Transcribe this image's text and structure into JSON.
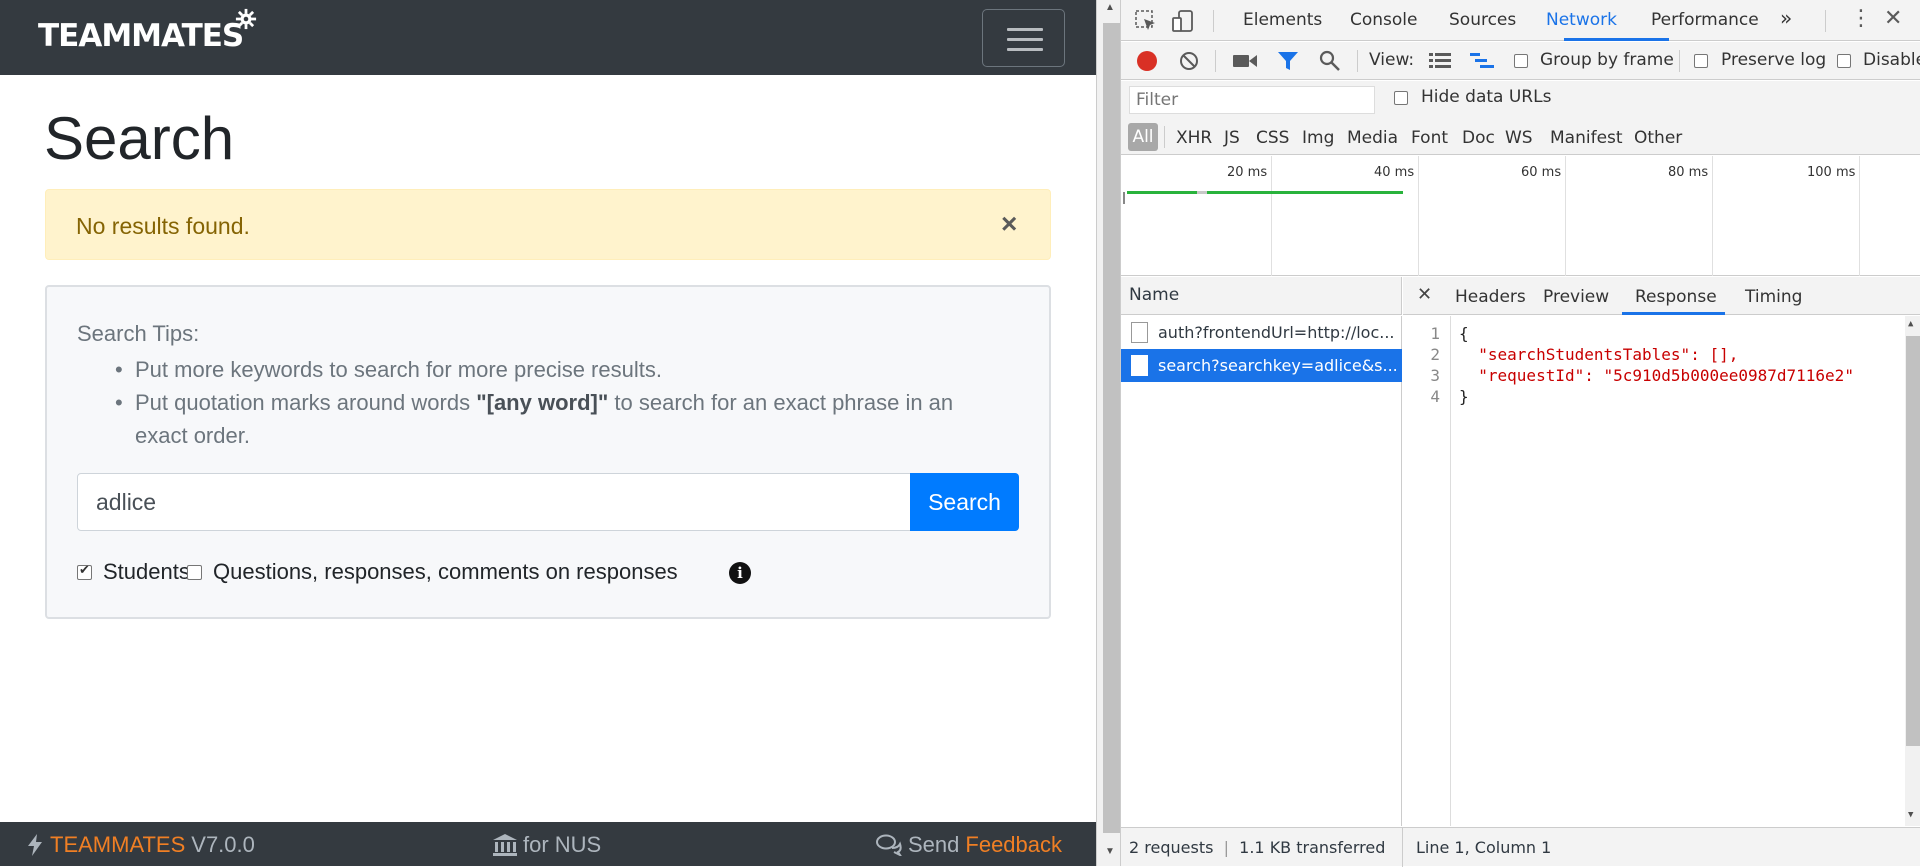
{
  "app": {
    "logo_text": "TEAMMATES",
    "page_title": "Search",
    "alert": {
      "text": "No results found.",
      "close": "×"
    },
    "tips": {
      "title": "Search Tips:",
      "item1": "Put more keywords to search for more precise results.",
      "item2_before": "Put quotation marks around words ",
      "item2_bold": "\"[any word]\"",
      "item2_after": " to search for an exact phrase in an exact order."
    },
    "search": {
      "value": "adlice",
      "button_label": "Search"
    },
    "options": {
      "students_label": "Students",
      "students_checked": true,
      "questions_label": "Questions, responses, comments on responses",
      "questions_checked": false
    },
    "footer": {
      "brand": "TEAMMATES",
      "version": "V7.0.0",
      "institution": "for NUS",
      "send": "Send",
      "feedback": "Feedback"
    },
    "colors": {
      "navbar": "#343a40",
      "accent": "#007bff",
      "footer_orange": "#f07f24",
      "alert_bg": "#fff3cd"
    }
  },
  "devtools": {
    "tabs": [
      "Elements",
      "Console",
      "Sources",
      "Network",
      "Performance"
    ],
    "active_tab": "Network",
    "more_tabs": "»",
    "toolbar": {
      "view_label": "View:",
      "group_by_frame": "Group by frame",
      "preserve_log": "Preserve log",
      "disable_cache": "Disable"
    },
    "filter": {
      "placeholder": "Filter",
      "hide_data_urls": "Hide data URLs"
    },
    "types": [
      "All",
      "XHR",
      "JS",
      "CSS",
      "Img",
      "Media",
      "Font",
      "Doc",
      "WS",
      "Manifest",
      "Other"
    ],
    "timeline_labels": [
      "20 ms",
      "40 ms",
      "60 ms",
      "80 ms",
      "100 ms"
    ],
    "requests": {
      "header": "Name",
      "rows": [
        {
          "name": "auth?frontendUrl=http://loc...",
          "selected": false
        },
        {
          "name": "search?searchkey=adlice&s...",
          "selected": true
        }
      ]
    },
    "detail_tabs": [
      "Headers",
      "Preview",
      "Response",
      "Timing"
    ],
    "active_detail_tab": "Response",
    "response": {
      "lines": [
        "{",
        "  \"searchStudentsTables\": [],",
        "  \"requestId\": \"5c910d5b000ee0987d7116e2\"",
        "}"
      ],
      "line_numbers": [
        "1",
        "2",
        "3",
        "4"
      ]
    },
    "status": {
      "requests": "2 requests",
      "separator": "|",
      "transferred": "1.1 KB transferred",
      "cursor": "Line 1, Column 1"
    }
  }
}
